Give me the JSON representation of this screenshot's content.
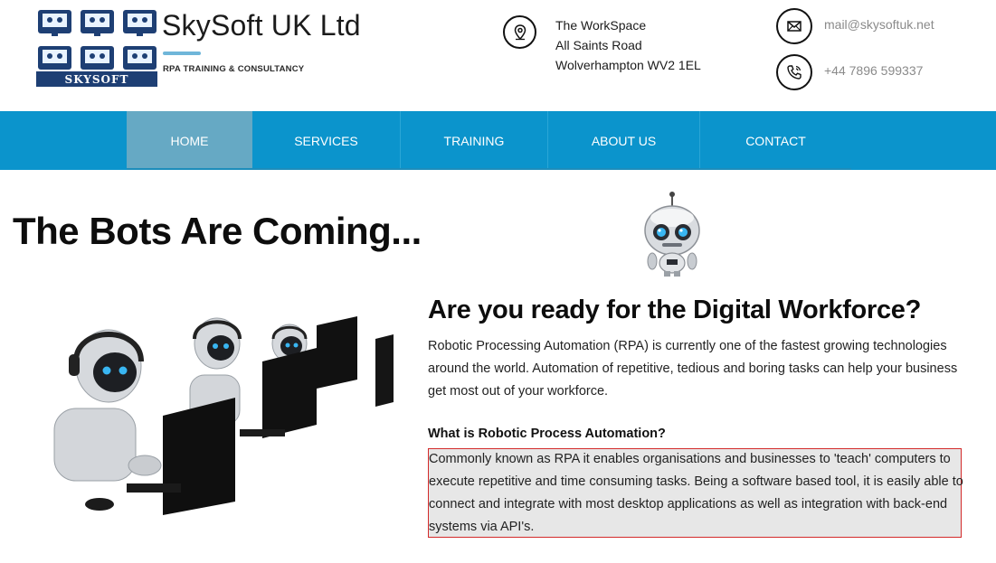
{
  "brand": {
    "name": "SkySoft UK Ltd",
    "tagline": "RPA TRAINING & CONSULTANCY",
    "logo_text": "SKYSOFT",
    "accent": "#0b94cc"
  },
  "contact": {
    "address_lines": [
      "The WorkSpace",
      "All Saints Road",
      "Wolverhampton WV2 1EL"
    ],
    "email": "mail@skysoftuk.net",
    "phone": "+44 7896 599337",
    "icons": [
      "location-pin-icon",
      "mail-icon",
      "phone-icon"
    ]
  },
  "nav": {
    "items": [
      {
        "label": "HOME",
        "active": true
      },
      {
        "label": "SERVICES",
        "active": false
      },
      {
        "label": "TRAINING",
        "active": false
      },
      {
        "label": "ABOUT US",
        "active": false
      },
      {
        "label": "CONTACT",
        "active": false
      }
    ],
    "bg_color": "#0b94cc",
    "active_color": "#66a9c4"
  },
  "hero": {
    "heading": "The Bots Are Coming...",
    "sub_heading": "Are you ready for the Digital Workforce?",
    "intro": "Robotic Processing Automation (RPA) is currently one of the fastest growing technologies around the world. Automation of repetitive, tedious and boring tasks can help your business get most out of your workforce.",
    "what_heading": "What is Robotic Process Automation?",
    "rpa_description": "Commonly known as RPA it  enables organisations and businesses to 'teach' computers to execute repetitive and time consuming tasks. Being a software based tool, it is easily able to connect and integrate with most desktop applications as well as integration with back-end systems via API's."
  }
}
